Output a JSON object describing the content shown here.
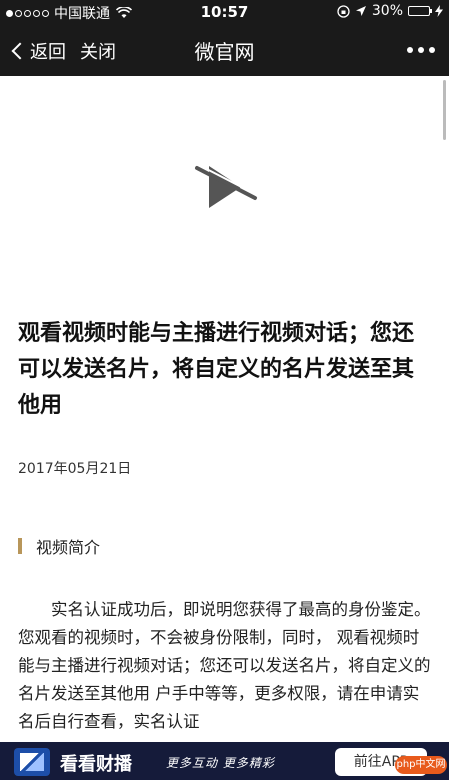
{
  "status_bar": {
    "carrier": "中国联通",
    "time": "10:57",
    "battery_percent": "30%",
    "battery_level": 0.3
  },
  "nav": {
    "back_label": "返回",
    "close_label": "关闭",
    "title": "微官网"
  },
  "article": {
    "title": "观看视频时能与主播进行视频对话；您还可以发送名片，将自定义的名片发送至其他用",
    "date": "2017年05月21日",
    "section_label": "视频简介",
    "body": "实名认证成功后，即说明您获得了最高的身份鉴定。您观看的视频时，不会被身份限制，同时， 观看视频时能与主播进行视频对话；您还可以发送名片，将自定义的名片发送至其他用 户手中等等，更多权限，请在申请实名后自行查看，实名认证"
  },
  "banner": {
    "brand": "看看财播",
    "slogan": "更多互动 更多精彩",
    "button_label": "前往APP",
    "watermark": "php中文网"
  },
  "colors": {
    "dark_bar": "#1a1a1a",
    "accent_section": "#b8965a",
    "banner_bg": "#151b3a"
  },
  "icons": {
    "video": "video-disabled-icon",
    "back": "chevron-left-icon",
    "more": "more-dots-icon"
  }
}
